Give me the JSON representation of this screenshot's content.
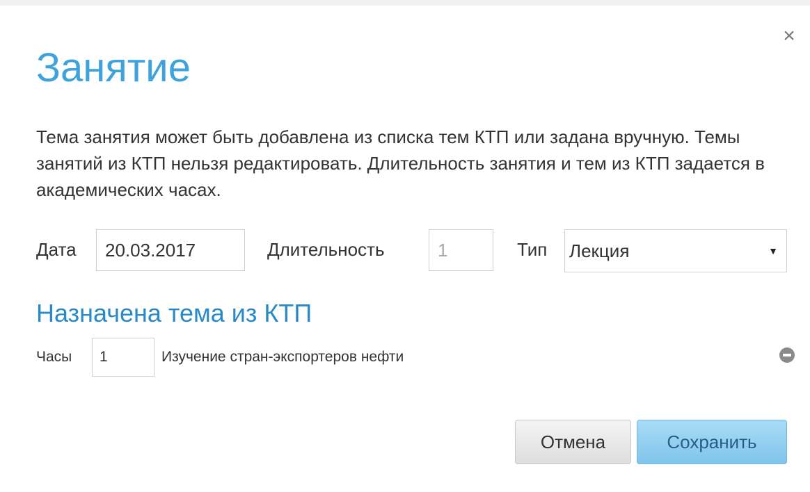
{
  "dialog": {
    "title": "Занятие",
    "close_label": "×",
    "description": "Тема занятия может быть добавлена из списка тем КТП или задана вручную. Темы занятий из КТП нельзя редактировать. Длительность занятия и тем из КТП задается в академических часах.",
    "form": {
      "date_label": "Дата",
      "date_value": "20.03.2017",
      "duration_label": "Длительность",
      "duration_value": "1",
      "type_label": "Тип",
      "type_value": "Лекция",
      "type_caret": "▼"
    },
    "assigned": {
      "section_title": "Назначена тема из КТП",
      "hours_label": "Часы",
      "hours_value": "1",
      "topic_name": "Изучение стран-экспортеров нефти",
      "remove_icon": "minus-circle-icon"
    },
    "buttons": {
      "cancel_label": "Отмена",
      "save_label": "Сохранить"
    }
  },
  "colors": {
    "title": "#3ea3dd",
    "section_title": "#2a8ac8",
    "save_button": "#8fcdf0",
    "cancel_button": "#e6e6e6"
  }
}
